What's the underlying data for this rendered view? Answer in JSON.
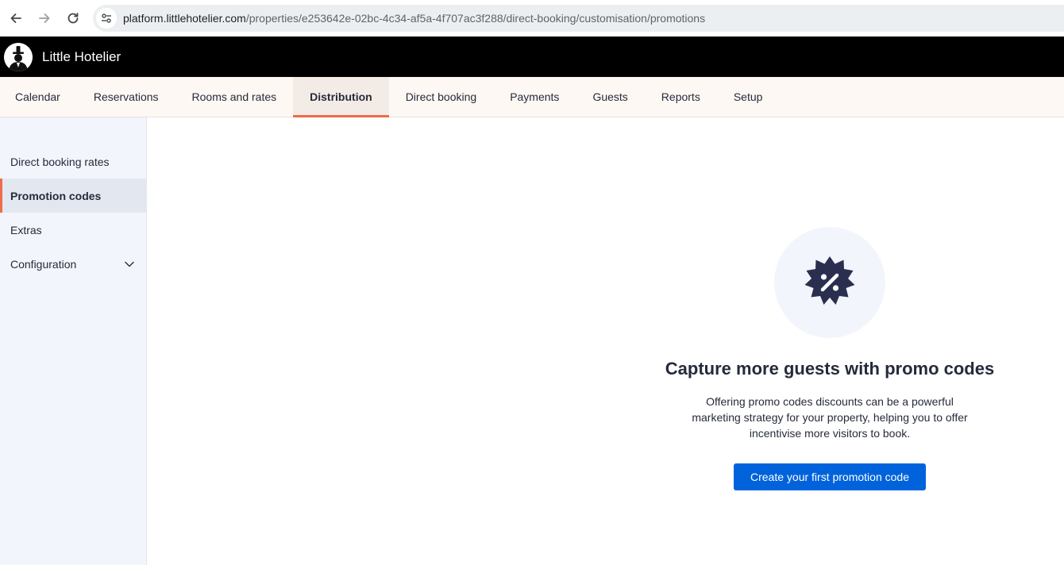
{
  "browser": {
    "url_host": "platform.littlehotelier.com",
    "url_path": "/properties/e253642e-02bc-4c34-af5a-4f707ac3f288/direct-booking/customisation/promotions"
  },
  "app": {
    "title": "Little Hotelier"
  },
  "top_nav": {
    "items": [
      {
        "label": "Calendar"
      },
      {
        "label": "Reservations"
      },
      {
        "label": "Rooms and rates"
      },
      {
        "label": "Distribution"
      },
      {
        "label": "Direct booking"
      },
      {
        "label": "Payments"
      },
      {
        "label": "Guests"
      },
      {
        "label": "Reports"
      },
      {
        "label": "Setup"
      }
    ],
    "active_index": 3
  },
  "sidebar": {
    "items": [
      {
        "label": "Direct booking rates"
      },
      {
        "label": "Promotion codes"
      },
      {
        "label": "Extras"
      },
      {
        "label": "Configuration"
      }
    ],
    "active_index": 1
  },
  "empty_state": {
    "icon": "discount-badge-icon",
    "title": "Capture more guests with promo codes",
    "description": "Offering promo codes discounts can be a powerful marketing strategy for your property, helping you to offer incentivise more visitors to book.",
    "button_label": "Create your first promotion code"
  },
  "colors": {
    "accent": "#ef6b4a",
    "primary_button": "#0063dc",
    "header_bg": "#000000",
    "sidebar_bg": "#f2f5fb",
    "icon_dark": "#2b2f4f"
  }
}
